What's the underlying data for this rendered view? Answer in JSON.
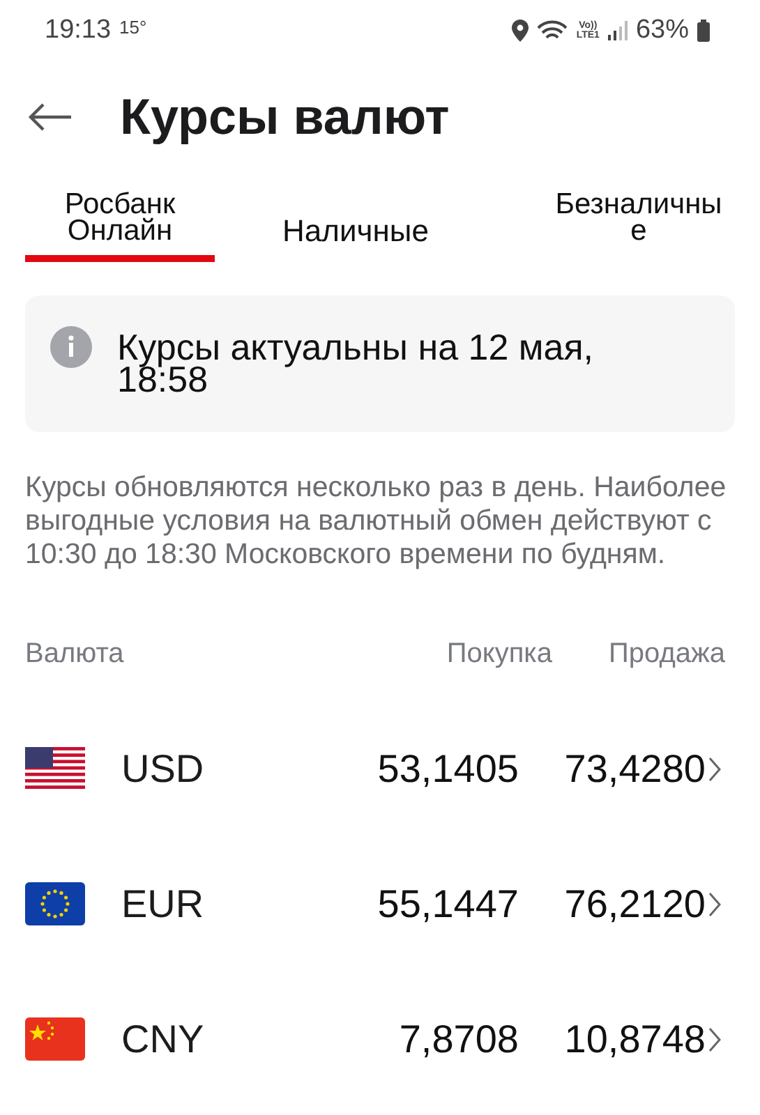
{
  "status_bar": {
    "time": "19:13",
    "temperature": "15°",
    "network_label": [
      "Vo))",
      "LTE1"
    ],
    "battery": "63%"
  },
  "header": {
    "title": "Курсы валют"
  },
  "tabs": [
    {
      "label": "Росбанк Онлайн",
      "selected": true
    },
    {
      "label": "Наличные",
      "selected": false
    },
    {
      "label": "Безналичные",
      "selected": false
    }
  ],
  "notice": {
    "text": "Курсы актуальны на 12 мая, 18:58"
  },
  "description": "Курсы обновляются несколько раз в день. Наиболее выгодные условия на валютный обмен действуют с 10:30 до 18:30 Московского времени по будням.",
  "table": {
    "columns": [
      "Валюта",
      "Покупка",
      "Продажа"
    ],
    "rows": [
      {
        "kind": "usd",
        "code": "USD",
        "buy": "53,1405",
        "sell": "73,4280"
      },
      {
        "kind": "eur",
        "code": "EUR",
        "buy": "55,1447",
        "sell": "76,2120"
      },
      {
        "kind": "cny",
        "code": "CNY",
        "buy": "7,8708",
        "sell": "10,8748"
      }
    ]
  }
}
